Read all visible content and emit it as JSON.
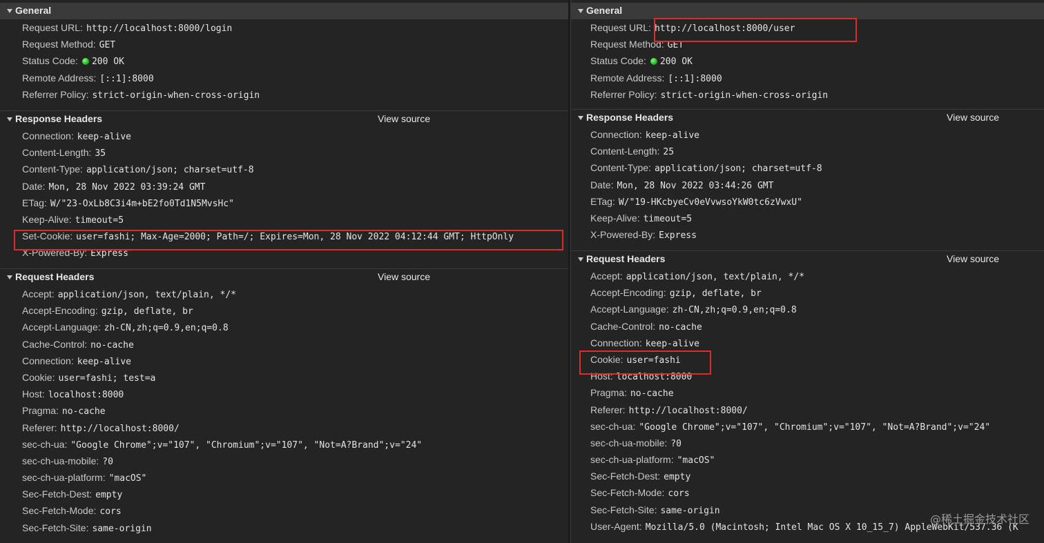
{
  "left": {
    "general": {
      "title": "General",
      "rows": [
        {
          "key": "Request URL:",
          "value": "http://localhost:8000/login"
        },
        {
          "key": "Request Method:",
          "value": "GET"
        },
        {
          "key": "Status Code:",
          "value": "200 OK",
          "status_dot": "green"
        },
        {
          "key": "Remote Address:",
          "value": "[::1]:8000"
        },
        {
          "key": "Referrer Policy:",
          "value": "strict-origin-when-cross-origin"
        }
      ]
    },
    "response_headers": {
      "title": "Response Headers",
      "view_source": "View source",
      "rows": [
        {
          "key": "Connection:",
          "value": "keep-alive"
        },
        {
          "key": "Content-Length:",
          "value": "35"
        },
        {
          "key": "Content-Type:",
          "value": "application/json; charset=utf-8"
        },
        {
          "key": "Date:",
          "value": "Mon, 28 Nov 2022 03:39:24 GMT"
        },
        {
          "key": "ETag:",
          "value": "W/\"23-OxLb8C3i4m+bE2fo0Td1N5MvsHc\""
        },
        {
          "key": "Keep-Alive:",
          "value": "timeout=5"
        },
        {
          "key": "Set-Cookie:",
          "value": "user=fashi; Max-Age=2000; Path=/; Expires=Mon, 28 Nov 2022 04:12:44 GMT; HttpOnly",
          "highlighted": true
        },
        {
          "key": "X-Powered-By:",
          "value": "Express"
        }
      ]
    },
    "request_headers": {
      "title": "Request Headers",
      "view_source": "View source",
      "rows": [
        {
          "key": "Accept:",
          "value": "application/json, text/plain, */*"
        },
        {
          "key": "Accept-Encoding:",
          "value": "gzip, deflate, br"
        },
        {
          "key": "Accept-Language:",
          "value": "zh-CN,zh;q=0.9,en;q=0.8"
        },
        {
          "key": "Cache-Control:",
          "value": "no-cache"
        },
        {
          "key": "Connection:",
          "value": "keep-alive"
        },
        {
          "key": "Cookie:",
          "value": "user=fashi; test=a"
        },
        {
          "key": "Host:",
          "value": "localhost:8000"
        },
        {
          "key": "Pragma:",
          "value": "no-cache"
        },
        {
          "key": "Referer:",
          "value": "http://localhost:8000/"
        },
        {
          "key": "sec-ch-ua:",
          "value": "\"Google Chrome\";v=\"107\", \"Chromium\";v=\"107\", \"Not=A?Brand\";v=\"24\""
        },
        {
          "key": "sec-ch-ua-mobile:",
          "value": "?0"
        },
        {
          "key": "sec-ch-ua-platform:",
          "value": "\"macOS\""
        },
        {
          "key": "Sec-Fetch-Dest:",
          "value": "empty"
        },
        {
          "key": "Sec-Fetch-Mode:",
          "value": "cors"
        },
        {
          "key": "Sec-Fetch-Site:",
          "value": "same-origin"
        }
      ]
    }
  },
  "right": {
    "general": {
      "title": "General",
      "rows": [
        {
          "key": "Request URL:",
          "value": "http://localhost:8000/user",
          "highlighted": true
        },
        {
          "key": "Request Method:",
          "value": "GET"
        },
        {
          "key": "Status Code:",
          "value": "200 OK",
          "status_dot": "green"
        },
        {
          "key": "Remote Address:",
          "value": "[::1]:8000"
        },
        {
          "key": "Referrer Policy:",
          "value": "strict-origin-when-cross-origin"
        }
      ]
    },
    "response_headers": {
      "title": "Response Headers",
      "view_source": "View source",
      "rows": [
        {
          "key": "Connection:",
          "value": "keep-alive"
        },
        {
          "key": "Content-Length:",
          "value": "25"
        },
        {
          "key": "Content-Type:",
          "value": "application/json; charset=utf-8"
        },
        {
          "key": "Date:",
          "value": "Mon, 28 Nov 2022 03:44:26 GMT"
        },
        {
          "key": "ETag:",
          "value": "W/\"19-HKcbyeCv0eVvwsoYkW0tc6zVwxU\""
        },
        {
          "key": "Keep-Alive:",
          "value": "timeout=5"
        },
        {
          "key": "X-Powered-By:",
          "value": "Express"
        }
      ]
    },
    "request_headers": {
      "title": "Request Headers",
      "view_source": "View source",
      "rows": [
        {
          "key": "Accept:",
          "value": "application/json, text/plain, */*"
        },
        {
          "key": "Accept-Encoding:",
          "value": "gzip, deflate, br"
        },
        {
          "key": "Accept-Language:",
          "value": "zh-CN,zh;q=0.9,en;q=0.8"
        },
        {
          "key": "Cache-Control:",
          "value": "no-cache"
        },
        {
          "key": "Connection:",
          "value": "keep-alive"
        },
        {
          "key": "Cookie:",
          "value": "user=fashi",
          "highlighted": true
        },
        {
          "key": "Host:",
          "value": "localhost:8000"
        },
        {
          "key": "Pragma:",
          "value": "no-cache"
        },
        {
          "key": "Referer:",
          "value": "http://localhost:8000/"
        },
        {
          "key": "sec-ch-ua:",
          "value": "\"Google Chrome\";v=\"107\", \"Chromium\";v=\"107\", \"Not=A?Brand\";v=\"24\""
        },
        {
          "key": "sec-ch-ua-mobile:",
          "value": "?0"
        },
        {
          "key": "sec-ch-ua-platform:",
          "value": "\"macOS\""
        },
        {
          "key": "Sec-Fetch-Dest:",
          "value": "empty"
        },
        {
          "key": "Sec-Fetch-Mode:",
          "value": "cors"
        },
        {
          "key": "Sec-Fetch-Site:",
          "value": "same-origin"
        },
        {
          "key": "User-Agent:",
          "value": "Mozilla/5.0 (Macintosh; Intel Mac OS X 10_15_7) AppleWebKit/537.36 (K"
        }
      ]
    }
  },
  "watermark": "@稀土掘金技术社区",
  "colors": {
    "highlight_box": "#e02b2b",
    "status_dot": "#22c022",
    "section_header_bg": "#3a3a3a"
  }
}
